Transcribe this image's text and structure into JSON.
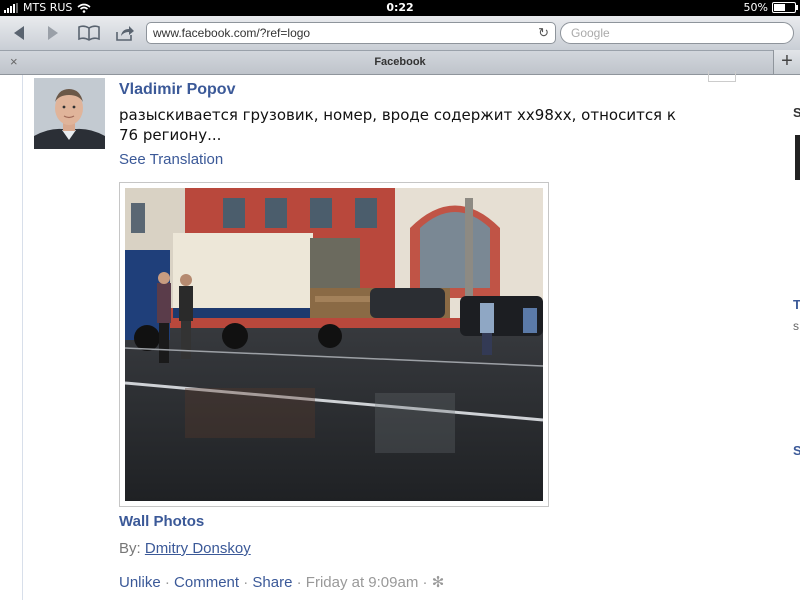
{
  "status_bar": {
    "carrier": "MTS RUS",
    "time": "0:22",
    "battery": "50%"
  },
  "browser": {
    "url": "www.facebook.com/?ref=logo",
    "search_placeholder": "Google",
    "tab_title": "Facebook",
    "tab_close": "×",
    "tab_add": "+"
  },
  "post": {
    "author": "Vladimir Popov",
    "text": "разыскивается грузовик, номер, вроде содержит хх98хх, относится к 76 региону...",
    "see_translation": "See Translation",
    "album": "Wall Photos",
    "by_label": "By:",
    "by_name": "Dmitry Donskoy",
    "actions": {
      "unlike": "Unlike",
      "comment": "Comment",
      "share": "Share",
      "time": "Friday at 9:09am",
      "sep": "·"
    }
  },
  "right_sidebar_fragments": [
    "S",
    "T",
    "s",
    "S"
  ]
}
